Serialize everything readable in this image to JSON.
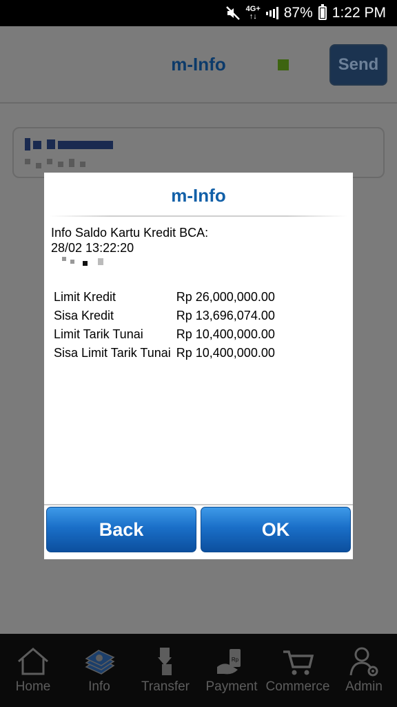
{
  "status_bar": {
    "network": "4G+",
    "battery": "87%",
    "time": "1:22 PM",
    "icons": [
      "mute-icon",
      "network-4g-icon",
      "signal-icon",
      "battery-icon"
    ]
  },
  "header": {
    "title": "m-Info",
    "send_label": "Send",
    "indicator_color": "#3d6410"
  },
  "dialog": {
    "title": "m-Info",
    "heading": "Info Saldo Kartu Kredit BCA:",
    "datetime": "28/02 13:22:20",
    "rows": [
      {
        "label": "Limit Kredit",
        "value": "Rp 26,000,000.00"
      },
      {
        "label": "Sisa Kredit",
        "value": "Rp 13,696,074.00"
      },
      {
        "label": "Limit Tarik Tunai",
        "value": "Rp 10,400,000.00"
      },
      {
        "label": "Sisa Limit Tarik Tunai",
        "value": "Rp 10,400,000.00"
      }
    ],
    "back_label": "Back",
    "ok_label": "OK"
  },
  "nav": {
    "items": [
      {
        "label": "Home",
        "icon": "home-icon"
      },
      {
        "label": "Info",
        "icon": "info-icon"
      },
      {
        "label": "Transfer",
        "icon": "transfer-icon"
      },
      {
        "label": "Payment",
        "icon": "payment-icon"
      },
      {
        "label": "Commerce",
        "icon": "commerce-icon"
      },
      {
        "label": "Admin",
        "icon": "admin-icon"
      }
    ]
  },
  "colors": {
    "accent": "#1260a8",
    "button": "#1a6fc8",
    "overlay": "#7b7b7b"
  }
}
